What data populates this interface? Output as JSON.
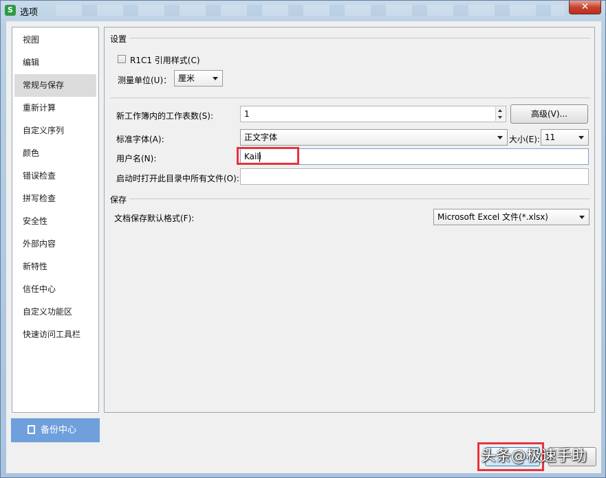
{
  "window": {
    "title": "选项",
    "app_icon_glyph": "S",
    "close_glyph": "✕"
  },
  "sidebar": {
    "items": [
      {
        "label": "视图"
      },
      {
        "label": "编辑"
      },
      {
        "label": "常规与保存",
        "active": true
      },
      {
        "label": "重新计算"
      },
      {
        "label": "自定义序列"
      },
      {
        "label": "颜色"
      },
      {
        "label": "错误检查"
      },
      {
        "label": "拼写检查"
      },
      {
        "label": "安全性"
      },
      {
        "label": "外部内容"
      },
      {
        "label": "新特性"
      },
      {
        "label": "信任中心"
      },
      {
        "label": "自定义功能区"
      },
      {
        "label": "快速访问工具栏"
      }
    ],
    "backup_label": "备份中心"
  },
  "settings": {
    "section_title": "设置",
    "r1c1_label": "R1C1 引用样式(C)",
    "r1c1_checked": false,
    "unit_label": "测量单位(U)：",
    "unit_value": "厘米",
    "sheets_label": "新工作簿内的工作表数(S):",
    "sheets_value": "1",
    "advanced_label": "高级(V)...",
    "font_label": "标准字体(A):",
    "font_value": "正文字体",
    "size_label": "大小(E):",
    "size_value": "11",
    "username_label": "用户名(N):",
    "username_value": "Kaili",
    "startup_label": "启动时打开此目录中所有文件(O):",
    "startup_value": ""
  },
  "save": {
    "section_title": "保存",
    "format_label": "文档保存默认格式(F):",
    "format_value": "Microsoft Excel 文件(*.xlsx)"
  },
  "watermark": {
    "text": "头条@极速手助"
  },
  "colors": {
    "highlight": "#e8333c",
    "backup_button": "#6fa0dc",
    "close_button": "#c7432f"
  }
}
